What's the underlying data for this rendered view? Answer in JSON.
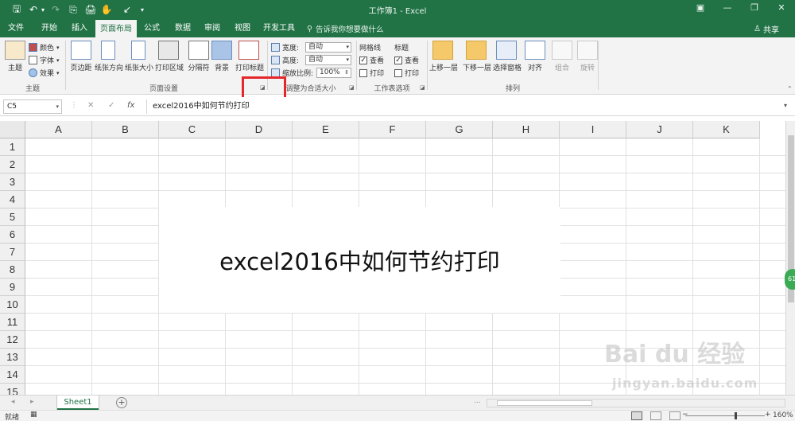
{
  "window": {
    "title": "工作簿1  -  Excel",
    "controls": [
      "▣",
      "—",
      "❐",
      "✕"
    ]
  },
  "quick_access": {
    "save": "🖫",
    "undo": "↶",
    "undo_drop": "▾",
    "redo": "↷",
    "more": "⎘",
    "preview": "🖨",
    "pointer": "✋",
    "sort": "↙",
    "customize": "▾"
  },
  "tabs": [
    "文件",
    "开始",
    "插入",
    "页面布局",
    "公式",
    "数据",
    "审阅",
    "视图",
    "开发工具"
  ],
  "active_tab": "页面布局",
  "tellme": {
    "icon": "⚲",
    "text": "告诉我你想要做什么"
  },
  "share": {
    "icon": "♙",
    "text": "共享"
  },
  "ribbon": {
    "themes": {
      "label": "主题",
      "big": "主题",
      "colors": "颜色",
      "fonts": "字体",
      "effects": "效果"
    },
    "page_setup": {
      "label": "页面设置",
      "buttons": [
        "页边距",
        "纸张方向",
        "纸张大小",
        "打印区域",
        "分隔符",
        "背景",
        "打印标题"
      ]
    },
    "scale": {
      "label": "调整为合适大小",
      "width_label": "宽度:",
      "width_value": "自动",
      "height_label": "高度:",
      "height_value": "自动",
      "scale_label": "缩放比例:",
      "scale_value": "100%"
    },
    "sheet_options": {
      "label": "工作表选项",
      "gridlines": "网格线",
      "headings": "标题",
      "view": "查看",
      "print": "打印"
    },
    "arrange": {
      "label": "排列",
      "buttons": [
        "上移一层",
        "下移一层",
        "选择窗格",
        "对齐",
        "组合",
        "旋转"
      ]
    }
  },
  "formula_bar": {
    "name_box": "C5",
    "cancel": "✕",
    "enter": "✓",
    "fx": "fx",
    "formula": "excel2016中如何节约打印"
  },
  "grid": {
    "columns": [
      "A",
      "B",
      "C",
      "D",
      "E",
      "F",
      "G",
      "H",
      "I",
      "J",
      "K"
    ],
    "rows": [
      "1",
      "2",
      "3",
      "4",
      "5",
      "6",
      "7",
      "8",
      "9",
      "10",
      "11",
      "12",
      "13",
      "14",
      "15"
    ]
  },
  "overlay_text": "excel2016中如何节约打印",
  "sheets": {
    "tabs": [
      "Sheet1"
    ],
    "add": "+",
    "prev": "◂",
    "next": "▸",
    "dots": "..."
  },
  "status": {
    "ready": "就绪",
    "macro_icon": "▦",
    "zoom": "160%",
    "zoom_minus": "−",
    "zoom_plus": "+"
  },
  "side_widget": "61",
  "watermark": {
    "main": "Bai du 经验",
    "sub": "jingyan.baidu.com"
  },
  "colors": {
    "accent": "#217346",
    "highlight": "#e4282a"
  }
}
